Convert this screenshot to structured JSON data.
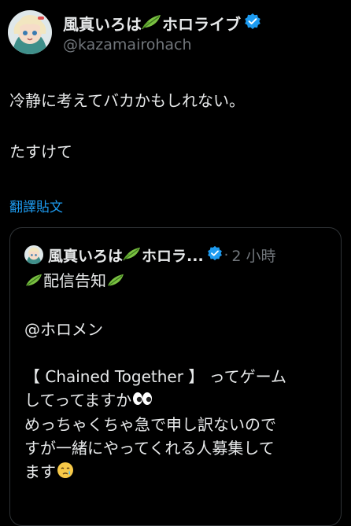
{
  "author": {
    "display_name": "風真いろは",
    "display_suffix": "ホロライブ",
    "handle": "@kazamairohach",
    "verified_color": "#1d9bf0",
    "avatar_icon": "anime-avatar-image"
  },
  "tweet": {
    "line1": "冷静に考えてバカかもしれない。",
    "line2": "たすけて"
  },
  "translate_label": "翻譯貼文",
  "quote": {
    "display_name": "風真いろは",
    "display_suffix": "ホロラ...",
    "time": "2 小時",
    "dot": "·",
    "title": "配信告知",
    "mention": "@ホロメン",
    "line_a": "【 Chained Together 】 ってゲーム",
    "line_b": "してってますか",
    "line_c": "めっちゃくちゃ急で申し訳ないので",
    "line_d": "すが一緒にやってくれる人募集して",
    "line_e": "ます"
  },
  "colors": {
    "background": "#000000",
    "text": "#e7e9ea",
    "muted": "#71767b",
    "link": "#1d9bf0",
    "border": "#2f3336",
    "leaf": "#7ac142"
  }
}
